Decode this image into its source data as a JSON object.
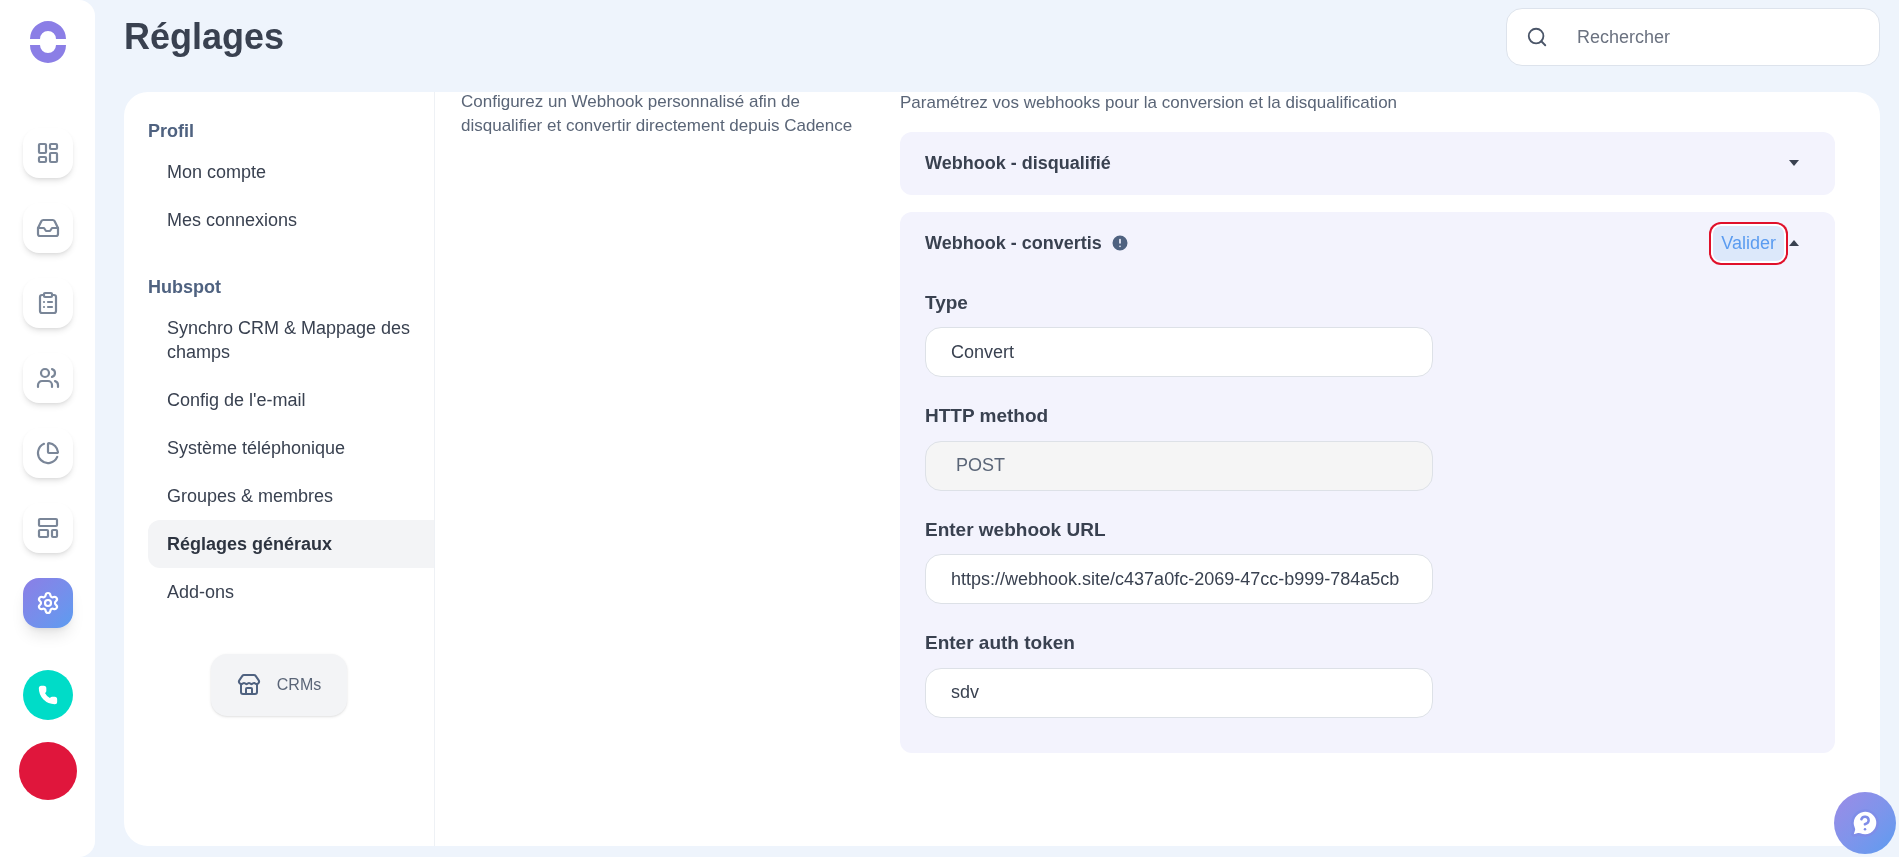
{
  "page_title": "Réglages",
  "search": {
    "placeholder": "Rechercher"
  },
  "rail": [
    {
      "kind": "dashboard",
      "selected": false
    },
    {
      "kind": "inbox",
      "selected": false
    },
    {
      "kind": "tasks",
      "selected": false
    },
    {
      "kind": "people",
      "selected": false
    },
    {
      "kind": "pie",
      "selected": false
    },
    {
      "kind": "layout",
      "selected": false
    },
    {
      "kind": "settings",
      "selected": true
    }
  ],
  "nav": [
    {
      "heading": "Profil",
      "items": [
        {
          "label": "Mon compte",
          "selected": false
        },
        {
          "label": "Mes connexions",
          "selected": false
        }
      ]
    },
    {
      "heading": "Hubspot",
      "items": [
        {
          "label": "Synchro CRM & Mappage des champs",
          "selected": false
        },
        {
          "label": "Config de l'e-mail",
          "selected": false
        },
        {
          "label": "Système téléphonique",
          "selected": false
        },
        {
          "label": "Groupes & membres",
          "selected": false
        },
        {
          "label": "Réglages généraux",
          "selected": true
        },
        {
          "label": "Add-ons",
          "selected": false
        }
      ]
    }
  ],
  "crm_button": "CRMs",
  "description": "Configurez un Webhook personnalisé afin de disqualifier et convertir directement depuis Cadence",
  "webhooks_intro": "Paramétrez vos webhooks pour la conversion et la disqualification",
  "webhooks": [
    {
      "title": "Webhook - disqualifié",
      "expanded": false,
      "warning": false
    },
    {
      "title": "Webhook - convertis",
      "expanded": true,
      "warning": true,
      "action": {
        "label": "Valider",
        "highlighted": true
      },
      "fields": [
        {
          "label": "Type",
          "value": "Convert",
          "disabled": false
        },
        {
          "label": "HTTP method",
          "value": "POST",
          "disabled": true
        },
        {
          "label": "Enter webhook URL",
          "value": "https://webhook.site/c437a0fc-2069-47cc-b999-784a5cb",
          "disabled": false
        },
        {
          "label": "Enter auth token",
          "value": "sdv",
          "disabled": false
        }
      ]
    }
  ]
}
